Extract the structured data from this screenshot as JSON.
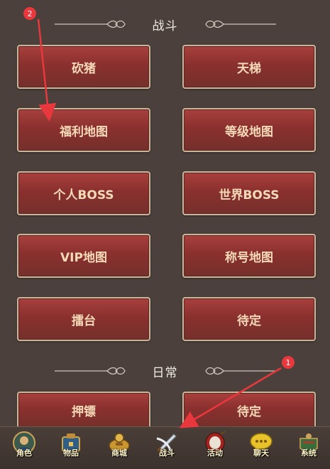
{
  "sections": [
    {
      "title": "战斗"
    },
    {
      "title": "日常"
    }
  ],
  "battle_buttons": [
    "砍猪",
    "天梯",
    "福利地图",
    "等级地图",
    "个人BOSS",
    "世界BOSS",
    "VIP地图",
    "称号地图",
    "擂台",
    "待定"
  ],
  "daily_buttons": [
    "押镖",
    "待定"
  ],
  "bottom_nav": [
    {
      "label": "角色",
      "icon": "character-icon"
    },
    {
      "label": "物品",
      "icon": "inventory-icon"
    },
    {
      "label": "商城",
      "icon": "shop-icon"
    },
    {
      "label": "战斗",
      "icon": "battle-icon"
    },
    {
      "label": "活动",
      "icon": "event-drum-icon"
    },
    {
      "label": "聊天",
      "icon": "chat-icon"
    },
    {
      "label": "系统",
      "icon": "system-icon"
    }
  ],
  "annotations": {
    "marker_1": "1",
    "marker_2": "2"
  },
  "colors": {
    "button_fill": "#8a302e",
    "button_border": "#c8b59a",
    "button_text": "#f3d9b8",
    "background": "#4b403b",
    "marker": "#e8383d"
  }
}
